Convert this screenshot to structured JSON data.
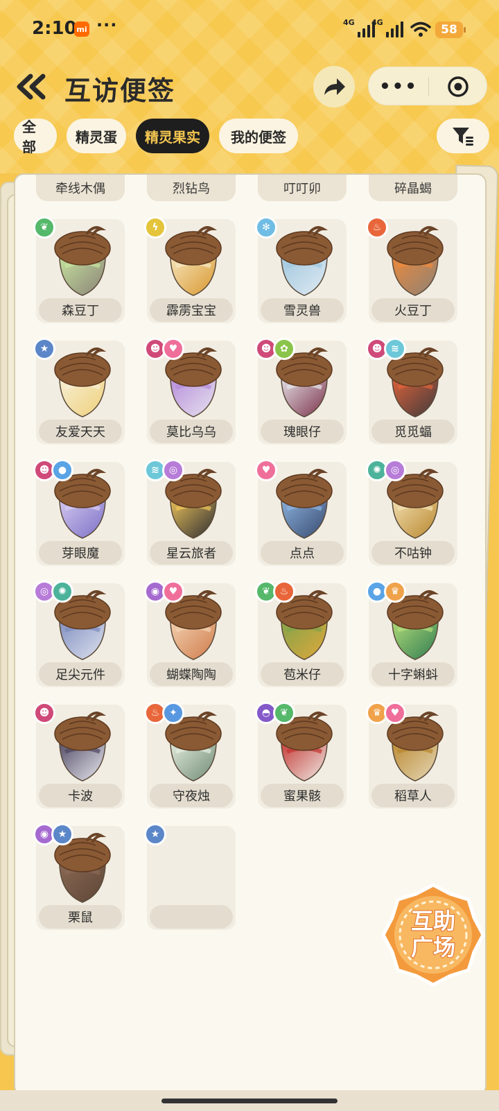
{
  "status": {
    "time": "2:10",
    "mi_label": "mi",
    "dots": "···",
    "net1": "4G",
    "net2": "4G",
    "battery": "58"
  },
  "header": {
    "title": "互访便签"
  },
  "tabs": [
    {
      "label": "全部",
      "active": false
    },
    {
      "label": "精灵蛋",
      "active": false
    },
    {
      "label": "精灵果实",
      "active": true
    },
    {
      "label": "我的便签",
      "active": false
    }
  ],
  "cut_row": [
    "牵线木偶",
    "烈钻鸟",
    "叮叮卯",
    "碎晶蝎"
  ],
  "items": [
    {
      "name": "森豆丁",
      "badges": [
        "leaf-icon"
      ],
      "colors": [
        "#8a8176",
        "#c8e6a0"
      ]
    },
    {
      "name": "霹雳宝宝",
      "badges": [
        "lightning-icon"
      ],
      "colors": [
        "#d8962c",
        "#f7e9c3"
      ]
    },
    {
      "name": "雪灵兽",
      "badges": [
        "snowflake-icon"
      ],
      "colors": [
        "#dfeaf2",
        "#9fc6de"
      ]
    },
    {
      "name": "火豆丁",
      "badges": [
        "flame-icon"
      ],
      "colors": [
        "#8d8276",
        "#f08a3a"
      ]
    },
    {
      "name": "友爱天天",
      "badges": [
        "star-icon"
      ],
      "colors": [
        "#efd07a",
        "#f7f0d8"
      ]
    },
    {
      "name": "莫比乌乌",
      "badges": [
        "demon-icon",
        "heart-icon"
      ],
      "colors": [
        "#e7e3ef",
        "#b48ad9"
      ]
    },
    {
      "name": "瑰眼仔",
      "badges": [
        "demon-icon",
        "bug-icon"
      ],
      "colors": [
        "#7a2f48",
        "#e8e8ec"
      ]
    },
    {
      "name": "觅觅蝠",
      "badges": [
        "demon-icon",
        "wing-icon"
      ],
      "colors": [
        "#3f3a3d",
        "#e2643a"
      ]
    },
    {
      "name": "芽眼魔",
      "badges": [
        "demon-icon",
        "water-icon"
      ],
      "colors": [
        "#7b6fc5",
        "#d7ccf2"
      ]
    },
    {
      "name": "星云旅者",
      "badges": [
        "wing-icon",
        "spiral-icon"
      ],
      "colors": [
        "#2a2b33",
        "#f2c75a"
      ]
    },
    {
      "name": "点点",
      "badges": [
        "heart-icon"
      ],
      "colors": [
        "#364a6e",
        "#8fb5e2"
      ]
    },
    {
      "name": "不咕钟",
      "badges": [
        "gear-icon",
        "spiral-icon"
      ],
      "colors": [
        "#b8862c",
        "#f4e2b6"
      ]
    },
    {
      "name": "足尖元件",
      "badges": [
        "spiral-icon",
        "gear-icon"
      ],
      "colors": [
        "#dfe3f0",
        "#7c8bbd"
      ]
    },
    {
      "name": "蝴蝶陶陶",
      "badges": [
        "candy-icon",
        "heart-icon"
      ],
      "colors": [
        "#cf7b4a",
        "#f4d4b4"
      ]
    },
    {
      "name": "苞米仔",
      "badges": [
        "leaf-icon",
        "flame-icon"
      ],
      "colors": [
        "#e0a83a",
        "#7fa34c"
      ]
    },
    {
      "name": "十字蝌蚪",
      "badges": [
        "water-icon",
        "crown-icon"
      ],
      "colors": [
        "#2f7b52",
        "#b7e07a"
      ]
    },
    {
      "name": "卡波",
      "badges": [
        "demon-icon"
      ],
      "colors": [
        "#ecebf2",
        "#4b4560"
      ]
    },
    {
      "name": "守夜烛",
      "badges": [
        "flame-icon",
        "sparkle-icon"
      ],
      "colors": [
        "#6f8a74",
        "#e8f0e2"
      ]
    },
    {
      "name": "蜜果骸",
      "badges": [
        "ghost-icon",
        "leaf-icon"
      ],
      "colors": [
        "#efece6",
        "#c3322f"
      ]
    },
    {
      "name": "稻草人",
      "badges": [
        "crown-icon",
        "heart-icon"
      ],
      "colors": [
        "#e6d8b8",
        "#b8862c"
      ]
    },
    {
      "name": "栗鼠",
      "badges": [
        "candy-icon",
        "star-icon"
      ],
      "colors": [
        "#5d4536",
        "#8c6a55"
      ]
    },
    {
      "name": "",
      "badges": [
        "star-icon"
      ],
      "colors": []
    }
  ],
  "badge_colors": {
    "leaf-icon": "#55b86a",
    "lightning-icon": "#e4c43a",
    "snowflake-icon": "#6fbde4",
    "flame-icon": "#e8663a",
    "star-icon": "#5b86c8",
    "demon-icon": "#cf4a78",
    "heart-icon": "#ef6f9a",
    "bug-icon": "#8ac44a",
    "wing-icon": "#6cc8d8",
    "water-icon": "#5aa4e6",
    "spiral-icon": "#b77bd8",
    "gear-icon": "#4cb39a",
    "candy-icon": "#a56ad0",
    "crown-icon": "#f0a24a",
    "ghost-icon": "#8458c8",
    "sparkle-icon": "#5898e0"
  },
  "help_badge": {
    "line1": "互助",
    "line2": "广场"
  }
}
